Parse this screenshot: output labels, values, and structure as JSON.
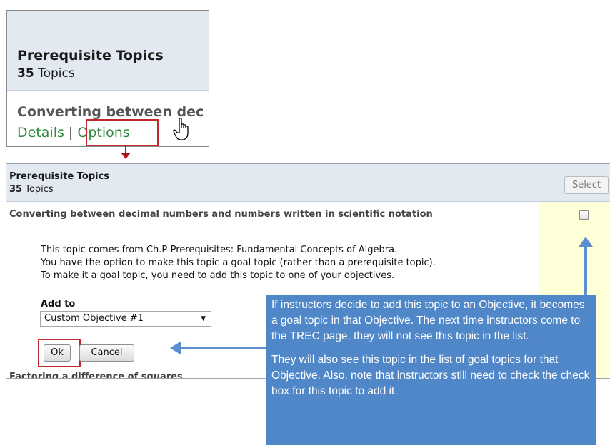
{
  "zoom": {
    "title": "Prerequisite Topics",
    "count_number": "35",
    "count_label": " Topics",
    "topic_partial": "Converting between dec",
    "link_details": "Details",
    "link_separator": " | ",
    "link_options": "Options"
  },
  "panel": {
    "title": "Prerequisite Topics",
    "count_number": "35",
    "count_label": " Topics",
    "select_button": "Select",
    "topic": "Converting between decimal numbers and numbers written in scientific notation",
    "description": [
      "This topic comes from Ch.P-Prerequisites: Fundamental Concepts of Algebra.",
      "You have the option to make this topic a goal topic (rather than a prerequisite topic).",
      "To make it a goal topic, you need to add this topic to one of your objectives."
    ],
    "add_to_label": "Add to",
    "add_to_value": "Custom Objective #1",
    "ok_button": "Ok",
    "cancel_button": "Cancel",
    "next_topic_partial": "Factoring a difference of squares"
  },
  "callout": {
    "paragraph1": "If instructors decide to add this topic to an Objective, it becomes a goal topic in that Objective. The next time instructors come to the TREC page, they will not see this topic in the list.",
    "paragraph2": "They will also see this topic in the list of goal topics for that Objective. Also, note that instructors still need to check the check box for this topic to add it."
  },
  "colors": {
    "header_bg": "#e3e9f1",
    "link_green": "#2f8a3e",
    "highlight_red": "#c0282d",
    "callout_blue": "#4f87c8",
    "checkbox_column": "#ffffd8"
  }
}
